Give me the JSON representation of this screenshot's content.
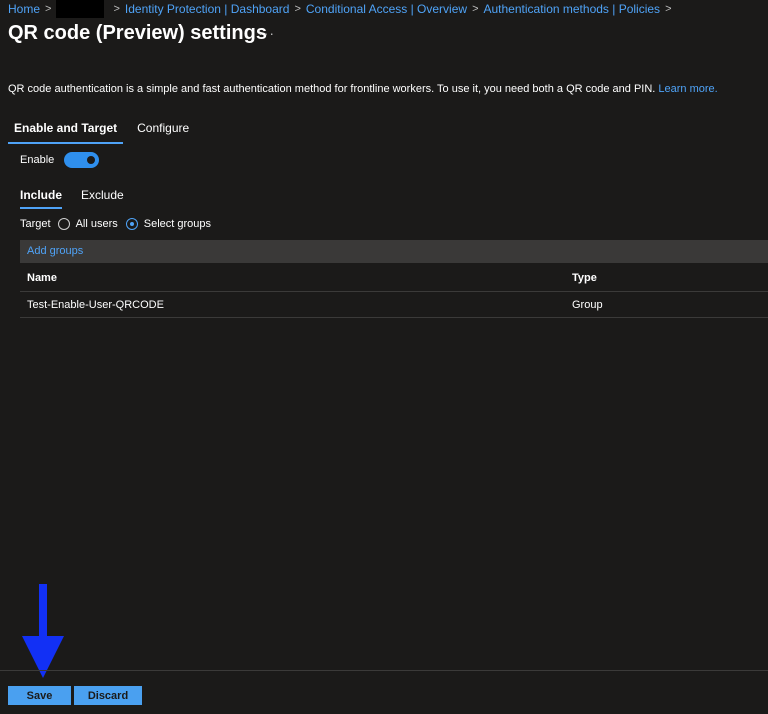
{
  "breadcrumb": {
    "items": [
      "Home",
      "Identity Protection | Dashboard",
      "Conditional Access | Overview",
      "Authentication methods | Policies"
    ],
    "separator": ">"
  },
  "header": {
    "title": "QR code (Preview) settings",
    "more": "···"
  },
  "description": {
    "text": "QR code authentication is a simple and fast authentication method for frontline workers. To use it, you need both a QR code and PIN.",
    "link": "Learn more."
  },
  "tabs": [
    "Enable and Target",
    "Configure"
  ],
  "enable": {
    "label": "Enable",
    "on": true
  },
  "subtabs": [
    "Include",
    "Exclude"
  ],
  "target": {
    "label": "Target",
    "options": [
      "All users",
      "Select groups"
    ],
    "selected": "Select groups"
  },
  "add_groups": "Add groups",
  "table": {
    "columns": [
      "Name",
      "Type"
    ],
    "rows": [
      {
        "name": "Test-Enable-User-QRCODE",
        "type": "Group"
      }
    ]
  },
  "footer": {
    "save": "Save",
    "discard": "Discard"
  },
  "colors": {
    "accent": "#4fa3f7",
    "background": "#1b1a19",
    "annotation_arrow": "#1230f5"
  }
}
